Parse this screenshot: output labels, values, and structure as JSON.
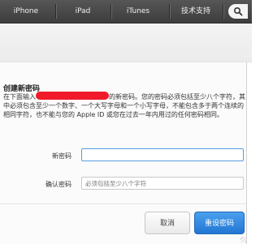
{
  "nav": {
    "items": [
      "iPhone",
      "iPad",
      "iTunes",
      "技术支持"
    ],
    "search_icon": "search-icon"
  },
  "dialog": {
    "title": "创建新密码",
    "desc_prefix": "在下面输入",
    "desc_suffix": "的新密码。您的密码必须包括至少八个字符，其中必须包含至少一个数字、一个大写字母和一个小写字母，不能包含多于两个连续的相同字符，也不能与您的 Apple ID 或您在过去一年内用过的任何密码相同。",
    "new_password_label": "新密码",
    "confirm_password_label": "确认密码",
    "confirm_placeholder": "必须包括至少八个字符",
    "cancel_label": "取消",
    "reset_label": "重设密码"
  },
  "colors": {
    "nav_bg": "#4a4a4a",
    "primary_button": "#2f86dd",
    "redaction": "#f01a2a"
  }
}
